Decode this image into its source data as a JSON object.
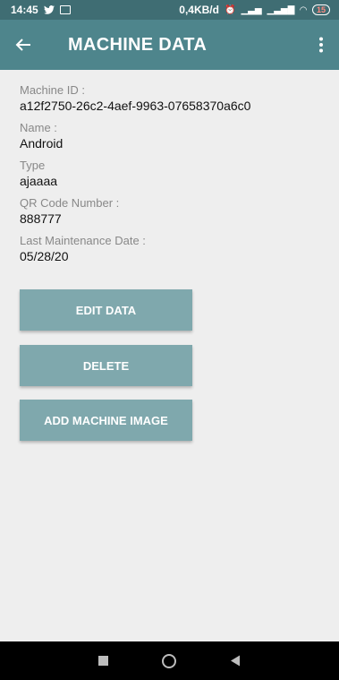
{
  "status_bar": {
    "time": "14:45",
    "network_speed": "0,4KB/d",
    "battery": "15"
  },
  "app_bar": {
    "title": "MACHINE DATA"
  },
  "fields": [
    {
      "label": "Machine ID :",
      "value": "a12f2750-26c2-4aef-9963-07658370a6c0"
    },
    {
      "label": "Name :",
      "value": "Android"
    },
    {
      "label": "Type",
      "value": "ajaaaa"
    },
    {
      "label": "QR Code Number :",
      "value": "888777"
    },
    {
      "label": "Last Maintenance Date :",
      "value": "05/28/20"
    }
  ],
  "buttons": {
    "edit": "EDIT DATA",
    "delete": "DELETE",
    "add_image": "ADD MACHINE IMAGE"
  },
  "colors": {
    "status_bar": "#3f6d73",
    "app_bar": "#4e858c",
    "button": "#7fa8ad",
    "background": "#eeeeee"
  }
}
